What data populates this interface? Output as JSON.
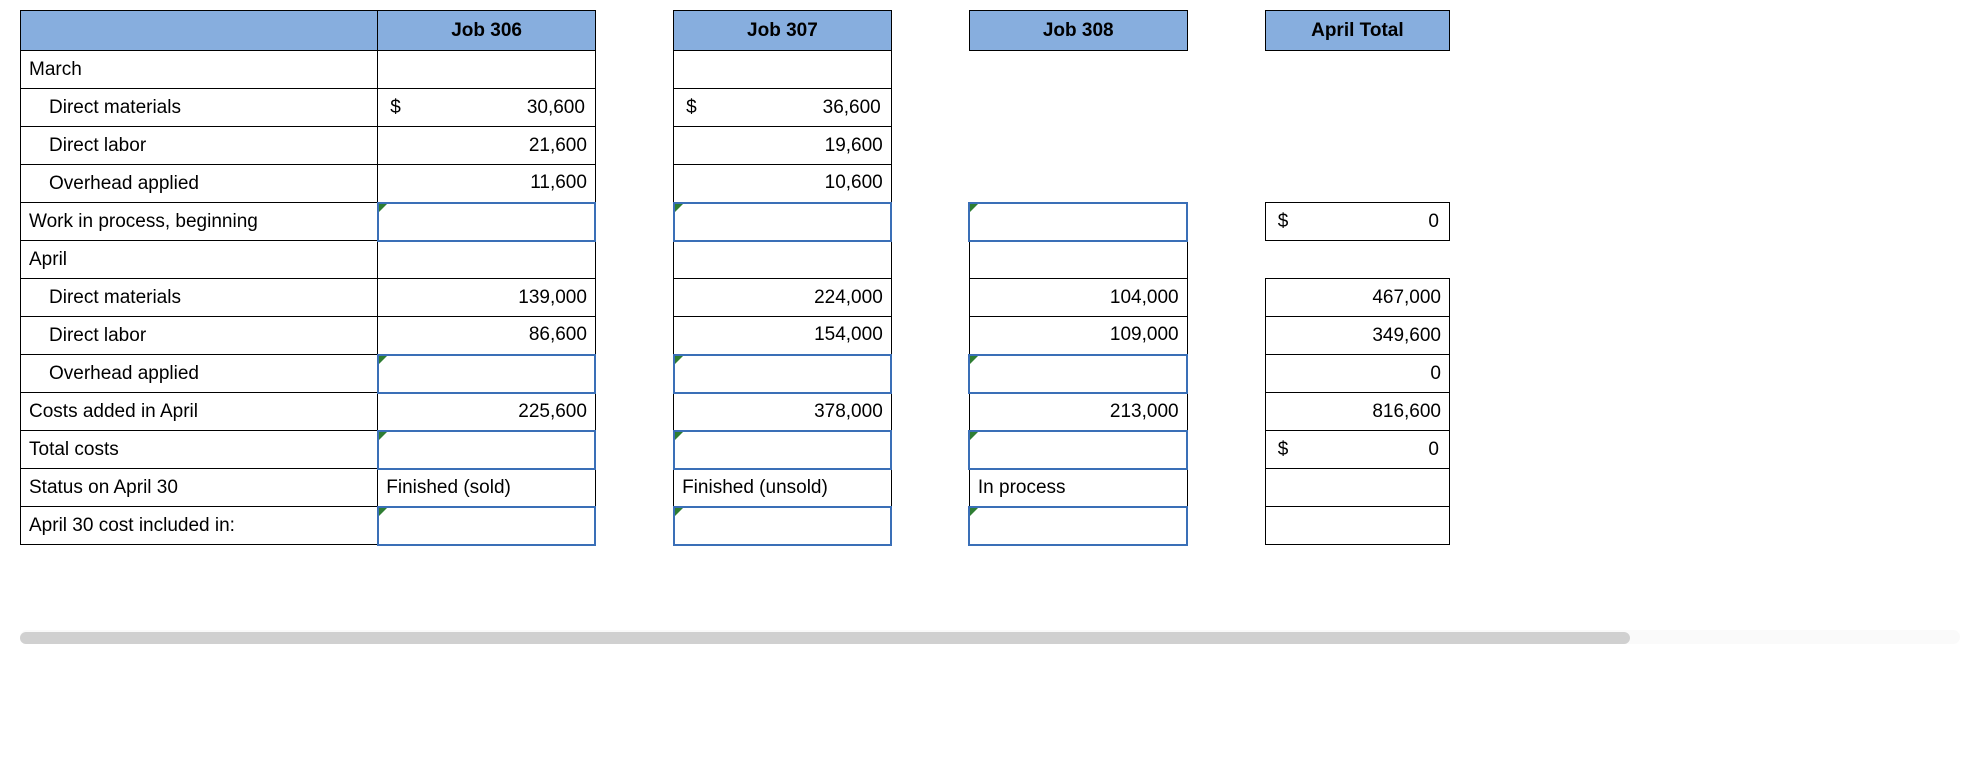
{
  "headers": {
    "job306": "Job 306",
    "job307": "Job 307",
    "job308": "Job 308",
    "total": "April Total"
  },
  "rows": {
    "march": {
      "label": "March"
    },
    "march_dm": {
      "label": "Direct materials",
      "j306_sym": "$",
      "j306": "30,600",
      "j307_sym": "$",
      "j307": "36,600"
    },
    "march_dl": {
      "label": "Direct labor",
      "j306": "21,600",
      "j307": "19,600"
    },
    "march_oh": {
      "label": "Overhead applied",
      "j306": "11,600",
      "j307": "10,600"
    },
    "wip_begin": {
      "label": "Work in process, beginning",
      "total_sym": "$",
      "total": "0"
    },
    "april": {
      "label": "April"
    },
    "april_dm": {
      "label": "Direct materials",
      "j306": "139,000",
      "j307": "224,000",
      "j308": "104,000",
      "total": "467,000"
    },
    "april_dl": {
      "label": "Direct labor",
      "j306": "86,600",
      "j307": "154,000",
      "j308": "109,000",
      "total": "349,600"
    },
    "april_oh": {
      "label": "Overhead applied",
      "total": "0"
    },
    "costs_added": {
      "label": "Costs added in April",
      "j306": "225,600",
      "j307": "378,000",
      "j308": "213,000",
      "total": "816,600"
    },
    "total_costs": {
      "label": "Total costs",
      "total_sym": "$",
      "total": "0"
    },
    "status": {
      "label": "Status on April 30",
      "j306": "Finished (sold)",
      "j307": "Finished (unsold)",
      "j308": "In process"
    },
    "included_in": {
      "label": "April 30 cost included in:"
    }
  }
}
